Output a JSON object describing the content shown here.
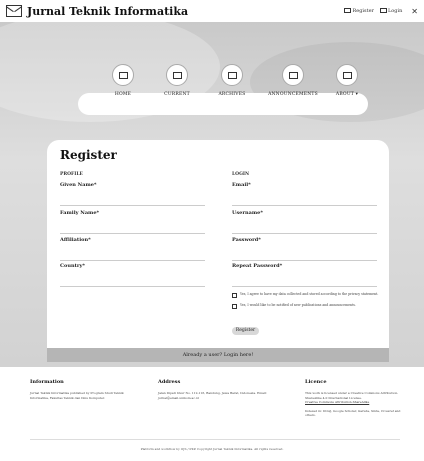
{
  "header": {
    "title": "Jurnal Teknik Informatika",
    "register_link": "Register",
    "login_link": "Login",
    "close_icon": "close-icon"
  },
  "nav": {
    "items": [
      {
        "label": "HOME",
        "icon": "envelope-icon"
      },
      {
        "label": "CURRENT",
        "icon": "envelope-icon"
      },
      {
        "label": "ARCHIVES",
        "icon": "envelope-icon"
      },
      {
        "label": "ANNOUNCEMENTS",
        "icon": "envelope-icon"
      },
      {
        "label": "ABOUT ▾",
        "icon": "envelope-icon"
      }
    ]
  },
  "form": {
    "title": "Register",
    "profile_heading": "PROFILE",
    "login_heading": "LOGIN",
    "fields_left": [
      {
        "label": "Given Name*"
      },
      {
        "label": "Family Name*"
      },
      {
        "label": "Affiliation*"
      },
      {
        "label": "Country*"
      }
    ],
    "fields_right": [
      {
        "label": "Email*"
      },
      {
        "label": "Username*"
      },
      {
        "label": "Password*"
      },
      {
        "label": "Repeat Password*"
      }
    ],
    "consent_1": "Yes, I agree to have my data collected and stored according to the privacy statement.",
    "consent_2": "Yes, I would like to be notified of new publications and announcements.",
    "register_button": "Register",
    "footer_link": "Already a user? Login here!"
  },
  "footer": {
    "col1_head": "Information",
    "col1_text": "Jurnal Teknik Informatika published by Program Studi Teknik Informatika, Fakultas Teknik dan Ilmu Komputer.",
    "col2_head": "Address",
    "col2_text": "Jalan Dipati Ukur No. 112-116, Bandung, Jawa Barat, Indonesia. Email: jurnal@email.unikom.ac.id",
    "col3_head": "Licence",
    "col3_text": "This work is licensed under a Creative Commons Attribution-ShareAlike 4.0 International License.",
    "col3_link": "Creative Commons Attribution-ShareAlike",
    "col3_text2": "Indexed in: DOAJ, Google Scholar, Garuda, Sinta, Crossref and others.",
    "copyright": "Platform and workflow by OJS / PKP. Copyright Jurnal Teknik Informatika. All rights reserved."
  }
}
